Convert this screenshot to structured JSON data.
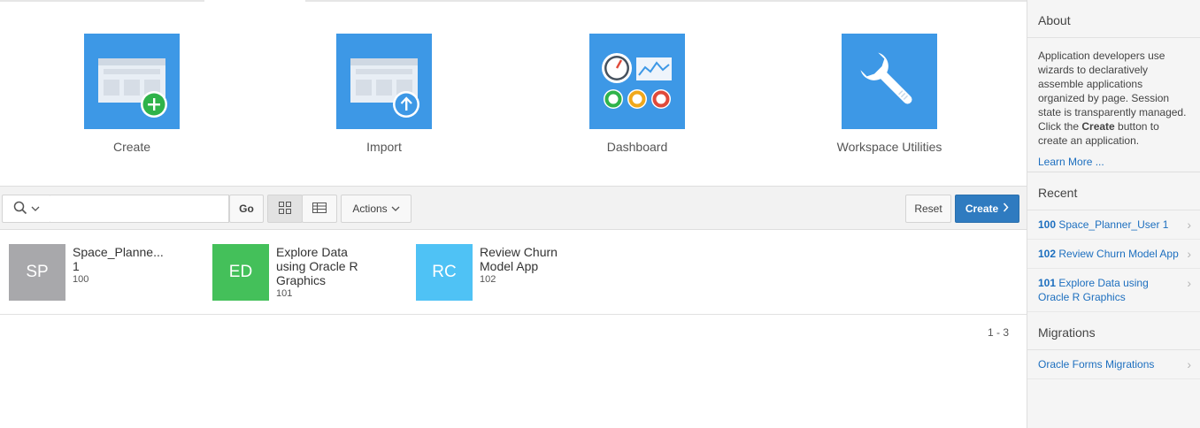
{
  "tiles": [
    {
      "label": "Create",
      "icon": "create-icon"
    },
    {
      "label": "Import",
      "icon": "import-icon"
    },
    {
      "label": "Dashboard",
      "icon": "dashboard-icon"
    },
    {
      "label": "Workspace Utilities",
      "icon": "wrench-icon"
    }
  ],
  "toolbar": {
    "go_label": "Go",
    "actions_label": "Actions",
    "reset_label": "Reset",
    "create_label": "Create",
    "search_value": ""
  },
  "apps": [
    {
      "initials": "SP",
      "name_line1": "Space_Planne...",
      "name_line2": "1",
      "name_line3": "",
      "id": "100",
      "color": "#a8a8ab"
    },
    {
      "initials": "ED",
      "name_line1": "Explore Data",
      "name_line2": "using Oracle R",
      "name_line3": "Graphics",
      "id": "101",
      "color": "#44c05a"
    },
    {
      "initials": "RC",
      "name_line1": "Review Churn",
      "name_line2": "Model App",
      "name_line3": "",
      "id": "102",
      "color": "#4fc2f5"
    }
  ],
  "pager": "1 - 3",
  "sidebar": {
    "about_title": "About",
    "about_text_1": "Application developers use wizards to declaratively assemble applications organized by page. Session state is transparently managed. Click the ",
    "about_bold": "Create",
    "about_text_2": " button to create an application.",
    "learn_more": "Learn More ...",
    "recent_title": "Recent",
    "recent": [
      {
        "id": "100",
        "name": "Space_Planner_User 1"
      },
      {
        "id": "102",
        "name": "Review Churn Model App"
      },
      {
        "id": "101",
        "name": "Explore Data using Oracle R Graphics"
      }
    ],
    "migrations_title": "Migrations",
    "migrations_link": "Oracle Forms Migrations"
  }
}
